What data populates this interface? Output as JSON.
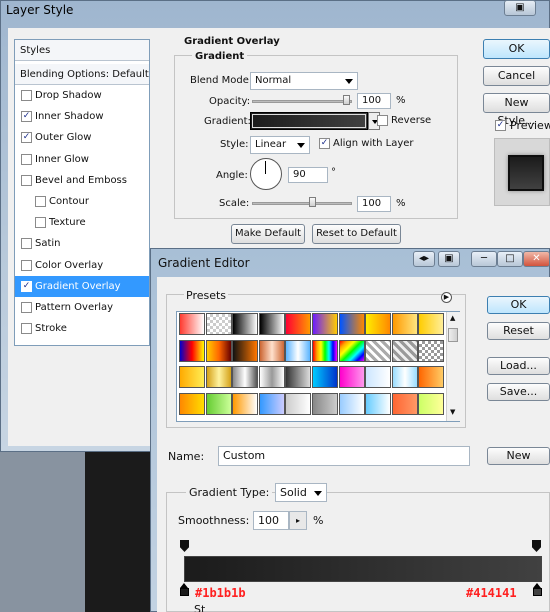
{
  "layer_style": {
    "title": "Layer Style",
    "styles_header": "Styles",
    "blending_options": "Blending Options: Default",
    "items": [
      {
        "label": "Drop Shadow",
        "checked": false
      },
      {
        "label": "Inner Shadow",
        "checked": true
      },
      {
        "label": "Outer Glow",
        "checked": true
      },
      {
        "label": "Inner Glow",
        "checked": false
      },
      {
        "label": "Bevel and Emboss",
        "checked": false
      },
      {
        "label": "Contour",
        "checked": false
      },
      {
        "label": "Texture",
        "checked": false
      },
      {
        "label": "Satin",
        "checked": false
      },
      {
        "label": "Color Overlay",
        "checked": false
      },
      {
        "label": "Gradient Overlay",
        "checked": true
      },
      {
        "label": "Pattern Overlay",
        "checked": false
      },
      {
        "label": "Stroke",
        "checked": false
      }
    ],
    "group_title": "Gradient Overlay",
    "subgroup_title": "Gradient",
    "blend_mode_label": "Blend Mode:",
    "blend_mode_value": "Normal",
    "opacity_label": "Opacity:",
    "opacity_value": "100",
    "opacity_unit": "%",
    "gradient_label": "Gradient:",
    "reverse_label": "Reverse",
    "style_label": "Style:",
    "style_value": "Linear",
    "align_label": "Align with Layer",
    "angle_label": "Angle:",
    "angle_value": "90",
    "angle_unit": "°",
    "scale_label": "Scale:",
    "scale_value": "100",
    "scale_unit": "%",
    "make_default": "Make Default",
    "reset_default": "Reset to Default",
    "ok": "OK",
    "cancel": "Cancel",
    "new_style": "New Style...",
    "preview": "Preview",
    "preview_checked": true
  },
  "gradient_editor": {
    "title": "Gradient Editor",
    "presets_label": "Presets",
    "ok": "OK",
    "reset": "Reset",
    "load": "Load...",
    "save": "Save...",
    "name_label": "Name:",
    "name_value": "Custom",
    "new_button": "New",
    "gradient_type_label": "Gradient Type:",
    "gradient_type_value": "Solid",
    "smoothness_label": "Smoothness:",
    "smoothness_value": "100",
    "smoothness_unit": "%",
    "stop_left_color": "#1b1b1b",
    "stop_right_color": "#414141",
    "stop_left_label": "#1b1b1b",
    "stop_right_label": "#414141",
    "stops_title": "St"
  },
  "colors": {
    "selection": "#3399ff",
    "annotation_red": "#ff2020"
  }
}
